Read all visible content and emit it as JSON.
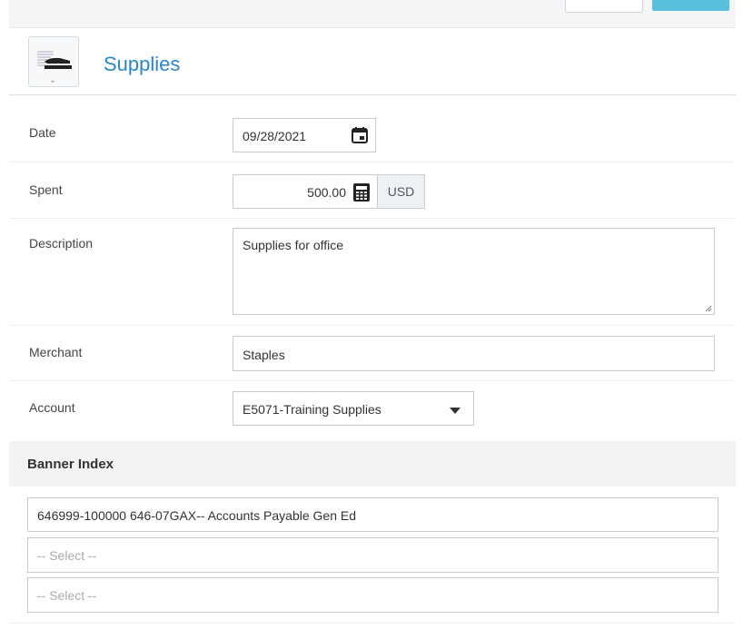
{
  "header": {
    "title": "Supplies",
    "icon": "stapler-icon"
  },
  "form": {
    "date": {
      "label": "Date",
      "value": "09/28/2021"
    },
    "spent": {
      "label": "Spent",
      "value": "500.00",
      "currency": "USD"
    },
    "description": {
      "label": "Description",
      "value": "Supplies for office"
    },
    "merchant": {
      "label": "Merchant",
      "value": "Staples"
    },
    "account": {
      "label": "Account",
      "value": "E5071-Training Supplies"
    }
  },
  "banner_index": {
    "title": "Banner Index",
    "fields": [
      {
        "value": "646999-100000 646-07GAX-- Accounts Payable Gen Ed"
      },
      {
        "placeholder": "-- Select --"
      },
      {
        "placeholder": "-- Select --"
      }
    ]
  },
  "colors": {
    "accent": "#2a86c7",
    "primary_button": "#5bc0de"
  }
}
